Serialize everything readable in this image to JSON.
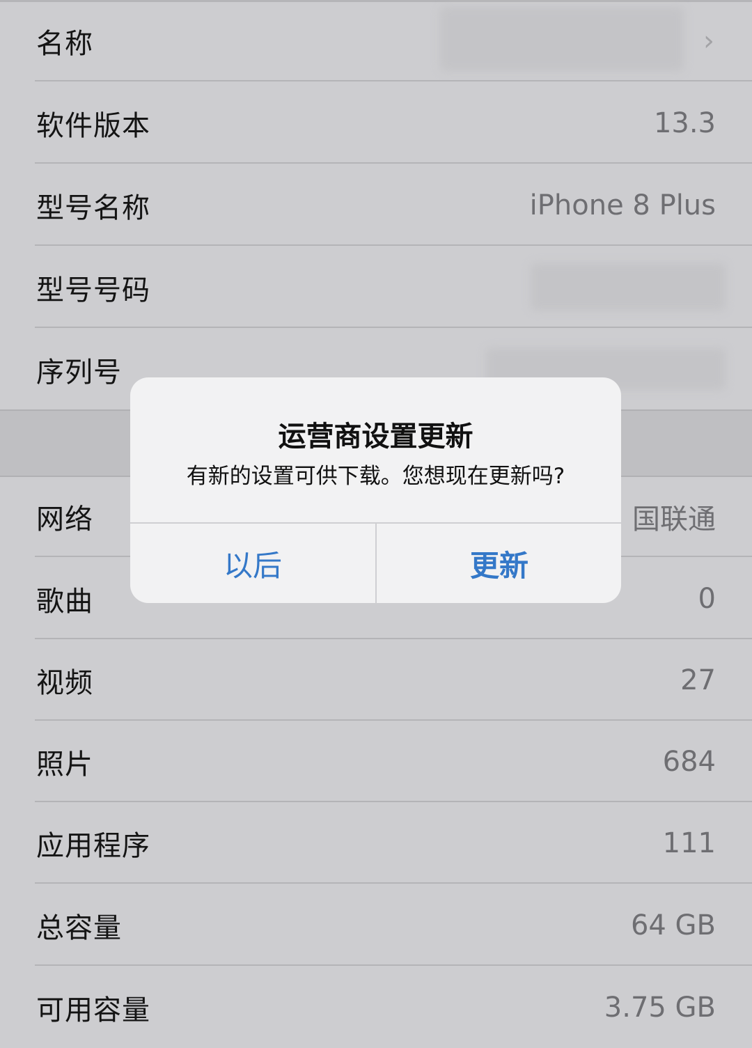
{
  "about_section_1": [
    {
      "label": "名称",
      "value": "",
      "value_redacted": true,
      "has_chevron": true
    },
    {
      "label": "软件版本",
      "value": "13.3"
    },
    {
      "label": "型号名称",
      "value": "iPhone 8 Plus"
    },
    {
      "label": "型号号码",
      "value": "",
      "value_redacted": true
    },
    {
      "label": "序列号",
      "value": "",
      "value_redacted": true
    }
  ],
  "about_section_2": [
    {
      "label": "网络",
      "value": "国联通"
    },
    {
      "label": "歌曲",
      "value": "0"
    },
    {
      "label": "视频",
      "value": "27"
    },
    {
      "label": "照片",
      "value": "684"
    },
    {
      "label": "应用程序",
      "value": "111"
    },
    {
      "label": "总容量",
      "value": "64 GB"
    },
    {
      "label": "可用容量",
      "value": "3.75 GB"
    }
  ],
  "icons": {
    "chevron": "chevron-right-icon"
  },
  "alert": {
    "title": "运营商设置更新",
    "message": "有新的设置可供下载。您想现在更新吗?",
    "later_button": "以后",
    "update_button": "更新"
  },
  "colors": {
    "accent": "#3478c8",
    "background": "#cdcdd0",
    "alert_bg": "#f2f2f3"
  }
}
